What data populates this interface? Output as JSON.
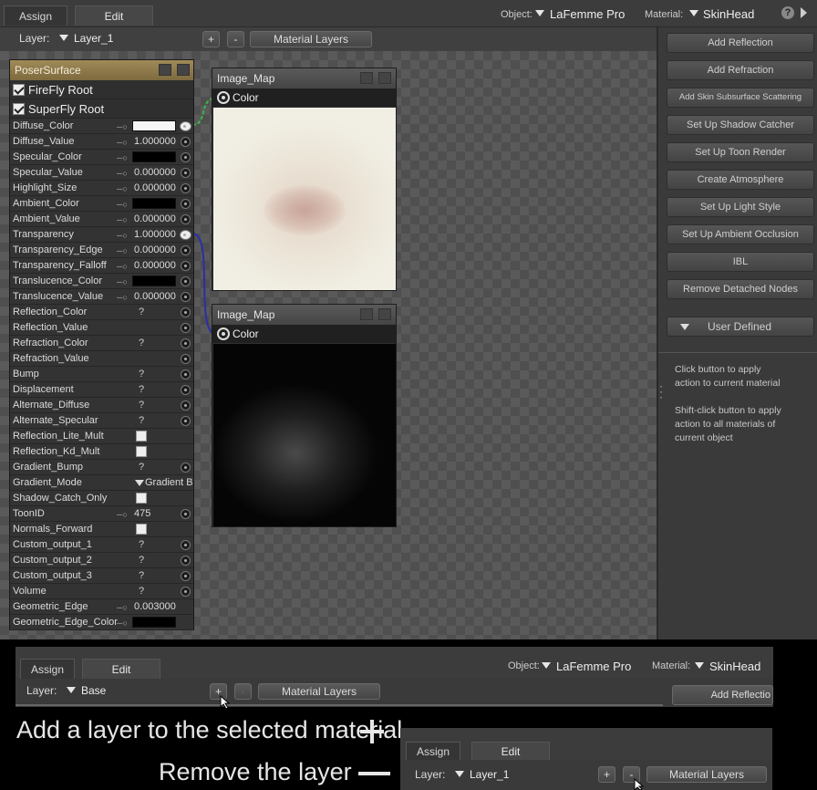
{
  "tabs": [
    "Assign",
    "Edit"
  ],
  "object": {
    "label": "Object:",
    "value": "LaFemme Pro"
  },
  "material": {
    "label": "Material:",
    "value": "SkinHead"
  },
  "layer": {
    "label": "Layer:",
    "value": "Layer_1"
  },
  "buttons": {
    "add": "+",
    "remove": "-",
    "material_layers": "Material Layers",
    "help": "?"
  },
  "node": {
    "title": "PoserSurface",
    "roots": [
      "FireFly Root",
      "SuperFly Root"
    ],
    "params": [
      {
        "n": "Diffuse_Color",
        "t": "color",
        "c": "#f5f5f5",
        "port": "linked"
      },
      {
        "n": "Diffuse_Value",
        "t": "num",
        "v": "1.000000"
      },
      {
        "n": "Specular_Color",
        "t": "color",
        "c": "#000000"
      },
      {
        "n": "Specular_Value",
        "t": "num",
        "v": "0.000000"
      },
      {
        "n": "Highlight_Size",
        "t": "num",
        "v": "0.000000"
      },
      {
        "n": "Ambient_Color",
        "t": "color",
        "c": "#000000"
      },
      {
        "n": "Ambient_Value",
        "t": "num",
        "v": "0.000000"
      },
      {
        "n": "Transparency",
        "t": "num",
        "v": "1.000000",
        "port": "linked"
      },
      {
        "n": "Transparency_Edge",
        "t": "num",
        "v": "0.000000"
      },
      {
        "n": "Transparency_Falloff",
        "t": "num",
        "v": "0.000000"
      },
      {
        "n": "Translucence_Color",
        "t": "color",
        "c": "#000000"
      },
      {
        "n": "Translucence_Value",
        "t": "num",
        "v": "0.000000"
      },
      {
        "n": "Reflection_Color",
        "t": "q",
        "v": "?"
      },
      {
        "n": "Reflection_Value",
        "t": "none"
      },
      {
        "n": "Refraction_Color",
        "t": "q",
        "v": "?"
      },
      {
        "n": "Refraction_Value",
        "t": "none"
      },
      {
        "n": "Bump",
        "t": "q",
        "v": "?"
      },
      {
        "n": "Displacement",
        "t": "q",
        "v": "?"
      },
      {
        "n": "Alternate_Diffuse",
        "t": "q",
        "v": "?"
      },
      {
        "n": "Alternate_Specular",
        "t": "q",
        "v": "?"
      },
      {
        "n": "Reflection_Lite_Mult",
        "t": "check",
        "port": "none"
      },
      {
        "n": "Reflection_Kd_Mult",
        "t": "check",
        "port": "none"
      },
      {
        "n": "Gradient_Bump",
        "t": "q",
        "v": "?"
      },
      {
        "n": "Gradient_Mode",
        "t": "menu",
        "v": "Gradient B",
        "port": "none"
      },
      {
        "n": "Shadow_Catch_Only",
        "t": "check",
        "port": "none"
      },
      {
        "n": "ToonID",
        "t": "num",
        "v": "475"
      },
      {
        "n": "Normals_Forward",
        "t": "check",
        "port": "none"
      },
      {
        "n": "Custom_output_1",
        "t": "q",
        "v": "?"
      },
      {
        "n": "Custom_output_2",
        "t": "q",
        "v": "?"
      },
      {
        "n": "Custom_output_3",
        "t": "q",
        "v": "?"
      },
      {
        "n": "Volume",
        "t": "q",
        "v": "?"
      },
      {
        "n": "Geometric_Edge",
        "t": "num",
        "v": "0.003000",
        "port": "none"
      },
      {
        "n": "Geometric_Edge_Color",
        "t": "color",
        "c": "#000000",
        "port": "none"
      }
    ]
  },
  "image_maps": [
    {
      "title": "Image_Map",
      "output": "Color"
    },
    {
      "title": "Image_Map",
      "output": "Color"
    }
  ],
  "wizard_buttons": [
    "Add Reflection",
    "Add Refraction",
    "Add Skin Subsurface Scattering",
    "Set Up Shadow Catcher",
    "Set Up Toon Render",
    "Create Atmosphere",
    "Set Up Light Style",
    "Set Up Ambient Occlusion",
    "IBL",
    "Remove Detached Nodes"
  ],
  "user_defined": "User Defined",
  "help_text": [
    "Click button to apply",
    "action to current material",
    "Shift-click button to apply",
    "action to all materials of",
    "current object"
  ],
  "bottom": {
    "layer_value": "Base",
    "add_reflection_partial": "Add Reflectio",
    "caption_add": "Add a layer to the selected material",
    "caption_remove": "Remove the layer"
  }
}
